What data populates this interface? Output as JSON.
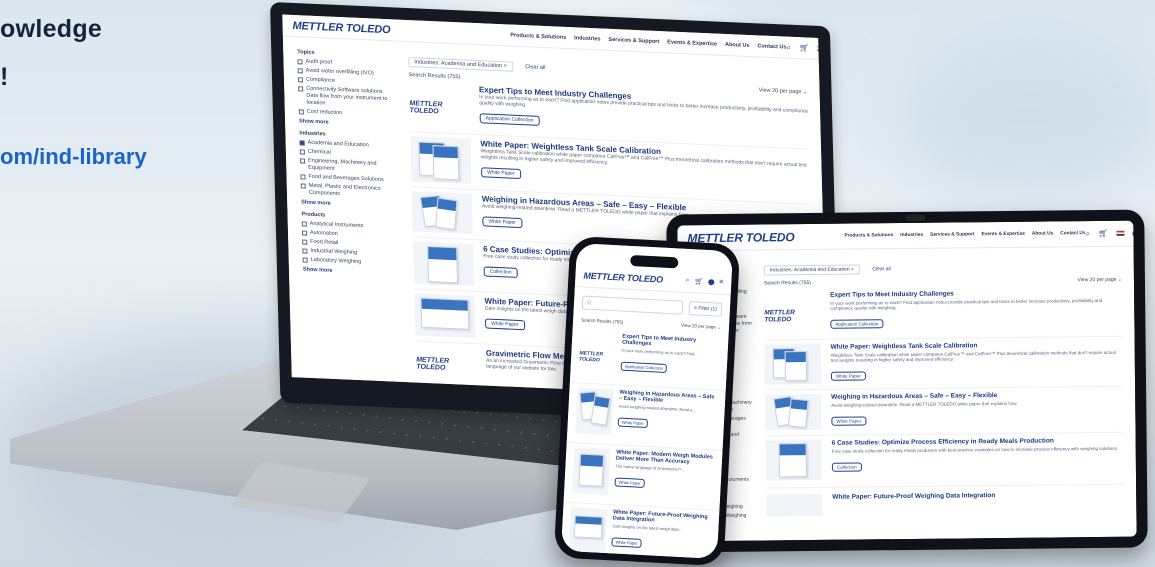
{
  "headline": {
    "line1": "owledge",
    "line2": "!",
    "url": "om/ind-library"
  },
  "site": {
    "logo": "METTLER TOLEDO",
    "menu": [
      "Products & Solutions",
      "Industries",
      "Services & Support",
      "Events & Expertise",
      "About Us",
      "Contact Us"
    ],
    "filter_chip": "Industries: Academia and Education ×",
    "clear_all": "Clear all",
    "results": "Search Results (755)",
    "per_page": "View 20 per page ⌄",
    "search_placeholder": "Q",
    "filter_button": "≡ Filter (1)",
    "topics": {
      "heading": "Topics",
      "items": [
        "Audit proof",
        "Avoid water overfilling (IVO)",
        "Compliance",
        "Connectivity Software solutions Data flow from your instrument to location",
        "Cost reduction"
      ],
      "more": "Show more"
    },
    "industries": {
      "heading": "Industries",
      "items": [
        "Academia and Education",
        "Chemical",
        "Engineering, Machinery and Equipment",
        "Food and Beverages Solutions",
        "Metal, Plastic and Electronics Components"
      ],
      "more": "Show more"
    },
    "products": {
      "heading": "Products",
      "items": [
        "Analytical Instruments",
        "Automation",
        "Food Retail",
        "Industrial Weighing",
        "Laboratory Weighing"
      ],
      "more": "Show more"
    },
    "cards": [
      {
        "title": "Expert Tips to Meet Industry Challenges",
        "desc": "In your work performing as to each? Find application notes provide practical tips and tricks to better increase productivity, profitability and compliance quality with weighing.",
        "tag": "Application Collection"
      },
      {
        "title": "White Paper: Weightless Tank Scale Calibration",
        "desc": "Weightless Tank Scale calibration white paper compares CalFree™ and CalFree™ Plus theoretical calibration methods that don't require actual test weights resulting in higher safety and improved efficiency.",
        "tag": "White Paper"
      },
      {
        "title": "Weighing in Hazardous Areas – Safe – Easy – Flexible",
        "desc": "Avoid weighing-related downtime. Read a METTLER TOLEDO white paper that explains how.",
        "tag": "White Paper"
      },
      {
        "title": "6 Case Studies: Optimize Process Efficiency in Ready Meals Production",
        "desc": "Free case study collection for ready meals producers with best practice examples on how to increase process efficiency with weighing solutions.",
        "tag": "Collection"
      },
      {
        "title": "White Paper: Future-Proof Weighing Data Integration",
        "desc": "Gain insights on the latest weigh data integration strategies and tools. Learn how to implement weighing solutions.",
        "tag": "White Paper"
      },
      {
        "title": "Gravimetric Flow Measurement in Industrial Environment",
        "desc": "As an increased Gravimetric Flow Measurement delivers accurate results. The native language of this document is not available in the selected language of our website for this.",
        "tag": ""
      }
    ],
    "phone_cards": [
      {
        "title": "Expert Tips to Meet Industry Challenges",
        "desc": "In your work performing as to each? Find...",
        "tag": "Application Collection"
      },
      {
        "title": "Weighing in Hazardous Areas – Safe – Easy – Flexible",
        "desc": "Avoid weighing-related downtime. Read a...",
        "tag": "White Paper"
      },
      {
        "title": "White Paper: Modern Weigh Modules Deliver More Than Accuracy",
        "desc": "The native language of Gravimetric™...",
        "tag": "White Paper"
      },
      {
        "title": "White Paper: Future-Proof Weighing Data Integration",
        "desc": "Gain insights on the latest weigh data...",
        "tag": "White Paper"
      }
    ]
  },
  "colors": {
    "brand": "#1e3f8a",
    "accent_url": "#1864c8",
    "headline": "#17233d"
  },
  "icons": [
    "search-icon",
    "cart-icon",
    "flag-icon",
    "user-icon"
  ]
}
